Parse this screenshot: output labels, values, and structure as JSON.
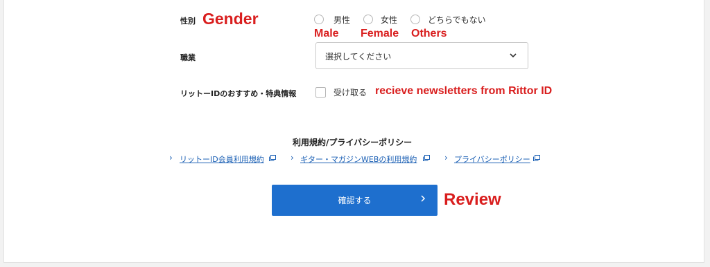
{
  "form": {
    "gender": {
      "label": "性別",
      "options": [
        "男性",
        "女性",
        "どちらでもない"
      ]
    },
    "occupation": {
      "label": "職業",
      "select_value": "選択してください"
    },
    "newsletter": {
      "label": "リットーIDのおすすめ・特典情報",
      "checkbox_label": "受け取る"
    }
  },
  "terms": {
    "title": "利用規約/プライバシーポリシー",
    "links": [
      "リットーID会員利用規約",
      "ギター・マガジンWEBの利用規約",
      "プライバシーポリシー"
    ]
  },
  "submit": {
    "label": "確認する"
  },
  "annotations": {
    "gender": "Gender",
    "male": "Male",
    "female": "Female",
    "others": "Others",
    "newsletter": "recieve newsletters from Rittor ID",
    "review": "Review"
  },
  "colors": {
    "annotation": "#d91e1e",
    "button": "#1e6fce",
    "link": "#1a5fb4"
  }
}
